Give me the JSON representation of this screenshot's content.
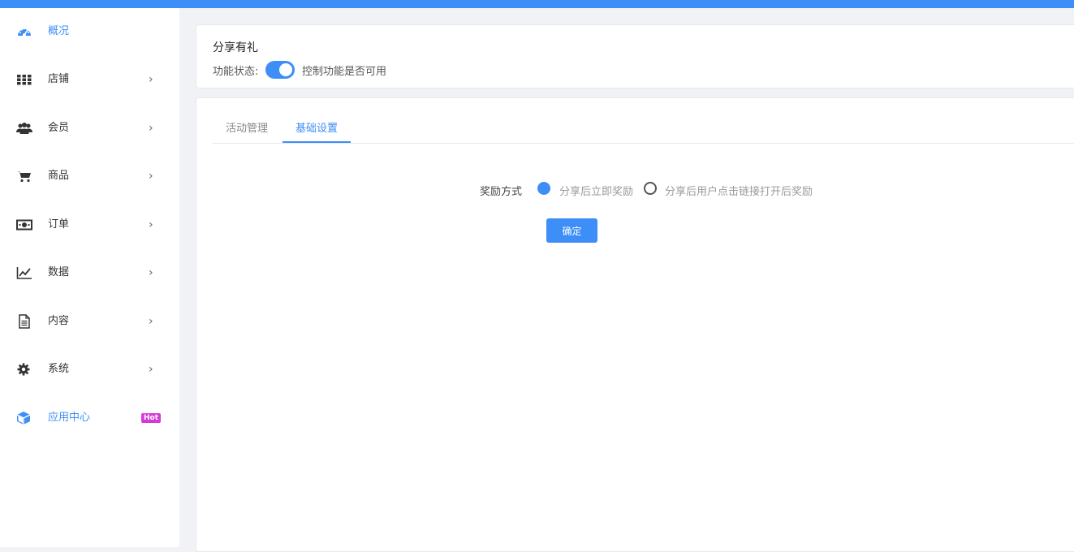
{
  "sidebar": {
    "items": [
      {
        "label": "概况",
        "icon": "dashboard-icon",
        "active": true
      },
      {
        "label": "店铺",
        "icon": "grid-icon"
      },
      {
        "label": "会员",
        "icon": "users-icon"
      },
      {
        "label": "商品",
        "icon": "cart-icon"
      },
      {
        "label": "订单",
        "icon": "money-icon"
      },
      {
        "label": "数据",
        "icon": "line-chart-icon"
      },
      {
        "label": "内容",
        "icon": "document-icon"
      },
      {
        "label": "系统",
        "icon": "gear-icon"
      },
      {
        "label": "应用中心",
        "icon": "cube-icon",
        "badge": "Hot",
        "active": true
      }
    ],
    "chevron": "›"
  },
  "header_card": {
    "title": "分享有礼",
    "status_label": "功能状态:",
    "status_on": true,
    "status_desc": "控制功能是否可用"
  },
  "settings": {
    "tabs": [
      {
        "label": "活动管理"
      },
      {
        "label": "基础设置",
        "active": true
      }
    ],
    "reward_label": "奖励方式",
    "options": [
      {
        "label": "分享后立即奖励",
        "checked": true
      },
      {
        "label": "分享后用户点击链接打开后奖励",
        "checked": false
      }
    ],
    "confirm_label": "确定"
  },
  "colors": {
    "accent": "#3e8ef7",
    "hot_badge": "#d63ad6"
  }
}
